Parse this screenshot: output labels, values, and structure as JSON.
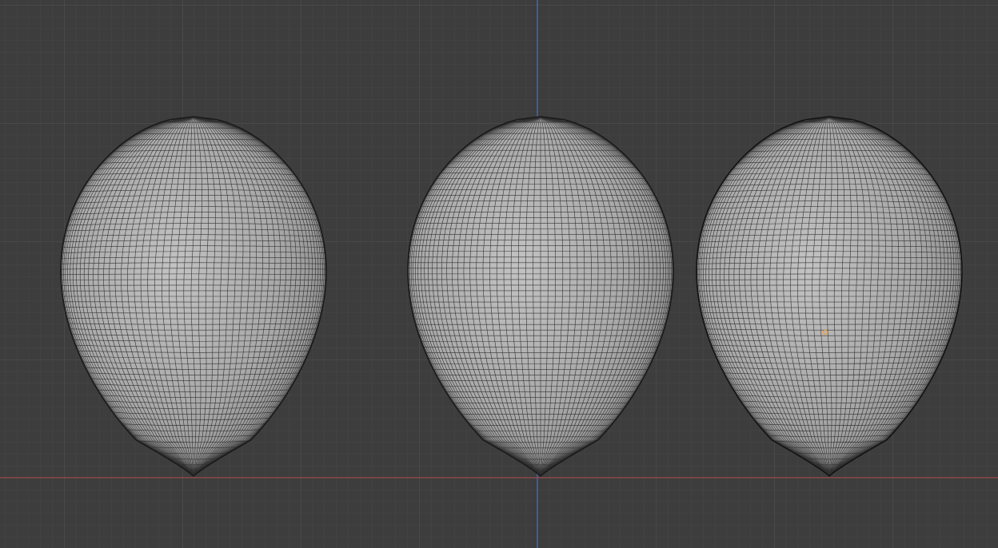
{
  "viewport": {
    "background_color": "#3d3d3d",
    "grid": "on",
    "grid_minor_color": "#474747",
    "grid_major_color": "#525252",
    "x_axis_color": "#b84a4f",
    "z_axis_color": "#4a7bc4",
    "view": "front-orthographic",
    "shading": "solid"
  },
  "objects": [
    {
      "name": "egg-left",
      "topology": "quad-sphere-wire",
      "selected": false,
      "surface_color": "#a9a9a9",
      "wire_color": "#1e1e1e"
    },
    {
      "name": "egg-center",
      "topology": "uv-sphere-wire",
      "selected": false,
      "surface_color": "#a9a9a9",
      "wire_color": "#1e1e1e"
    },
    {
      "name": "egg-right",
      "topology": "quad-sphere-wire",
      "selected": true,
      "surface_color": "#a9a9a9",
      "wire_color": "#1e1e1e"
    }
  ],
  "origin_marker": {
    "visible": true,
    "color": "#f2a03d",
    "on_object": "egg-right"
  }
}
